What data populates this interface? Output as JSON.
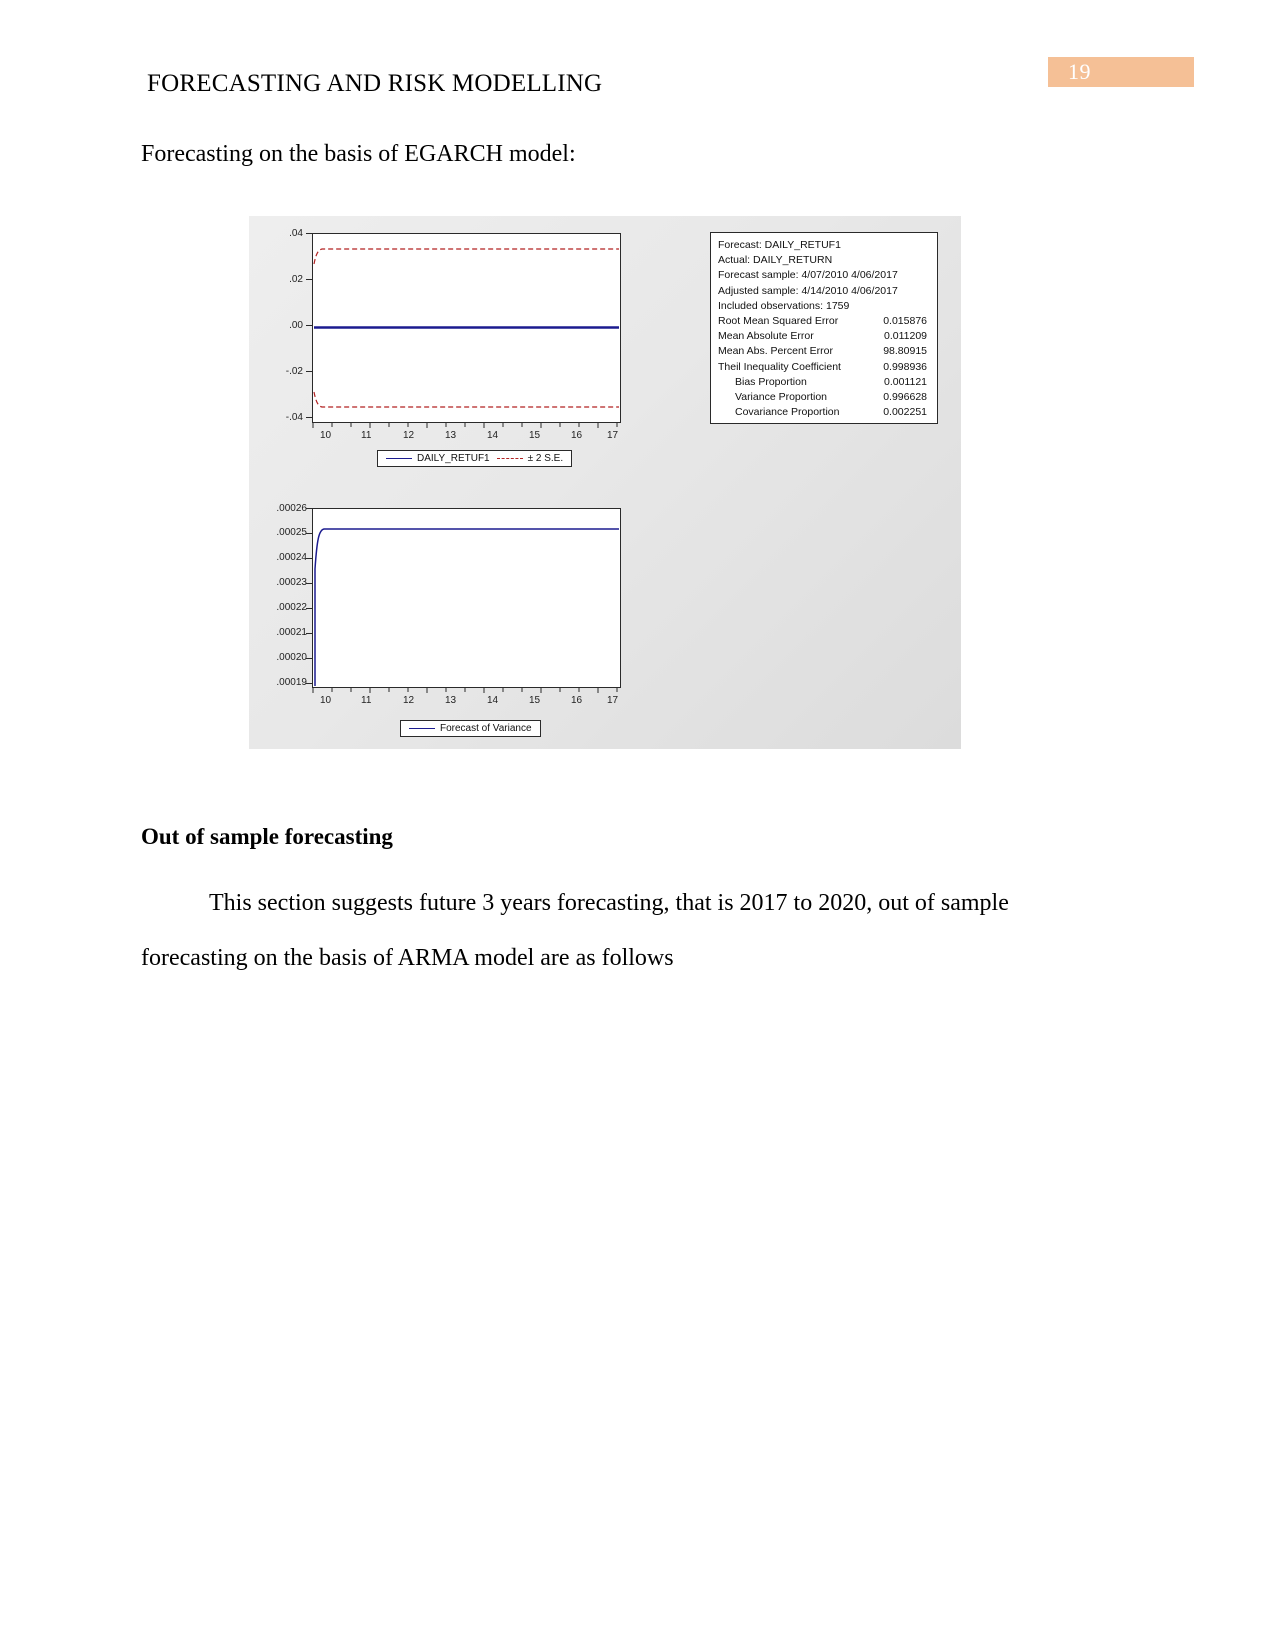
{
  "page": {
    "number": "19",
    "badge_color": "#f5c096",
    "header_title": "FORECASTING AND RISK MODELLING"
  },
  "body": {
    "intro_line": "Forecasting on the basis of EGARCH model:",
    "section_heading": "Out of sample forecasting",
    "paragraph_1": "This section suggests future 3 years forecasting, that is 2017 to 2020, out of sample",
    "paragraph_2": "forecasting on the basis of ARMA model are as follows"
  },
  "stats": {
    "forecast_label": "Forecast: DAILY_RETUF1",
    "actual_label": "Actual: DAILY_RETURN",
    "forecast_sample": "Forecast sample: 4/07/2010 4/06/2017",
    "adjusted_sample": "Adjusted sample: 4/14/2010 4/06/2017",
    "included_observations": "Included observations: 1759",
    "metrics": [
      {
        "label": "Root Mean Squared Error",
        "value": "0.015876",
        "indent": false
      },
      {
        "label": "Mean Absolute Error",
        "value": "0.011209",
        "indent": false
      },
      {
        "label": "Mean Abs. Percent Error",
        "value": "98.80915",
        "indent": false
      },
      {
        "label": "Theil Inequality Coefficient",
        "value": "0.998936",
        "indent": false
      },
      {
        "label": "Bias Proportion",
        "value": "0.001121",
        "indent": true
      },
      {
        "label": "Variance Proportion",
        "value": "0.996628",
        "indent": true
      },
      {
        "label": "Covariance Proportion",
        "value": "0.002251",
        "indent": true
      }
    ]
  },
  "chart_data": [
    {
      "type": "line",
      "title": "Forecast of DAILY_RETUF1 with +/- 2 S.E. bands",
      "xlabel": "",
      "ylabel": "",
      "x": [
        10,
        11,
        12,
        13,
        14,
        15,
        16,
        17
      ],
      "xtick_labels": [
        "10",
        "11",
        "12",
        "13",
        "14",
        "15",
        "16",
        "17"
      ],
      "ytick_labels": [
        ".04",
        ".02",
        ".00",
        "-.02",
        "-.04"
      ],
      "ylim": [
        -0.04,
        0.04
      ],
      "xlim": [
        10,
        17
      ],
      "grid": false,
      "legend_position": "bottom",
      "series": [
        {
          "name": "DAILY_RETUF1",
          "color": "#1b1b8f",
          "style": "solid",
          "values": [
            0.0002,
            0.0002,
            0.0002,
            0.0002,
            0.0002,
            0.0002,
            0.0002,
            0.0002
          ]
        },
        {
          "name": "+ 2 S.E.",
          "color": "#b22222",
          "style": "dashed",
          "values": [
            0.0275,
            0.0312,
            0.0315,
            0.0315,
            0.0315,
            0.0315,
            0.0315,
            0.0315
          ]
        },
        {
          "name": "- 2 S.E.",
          "color": "#b22222",
          "style": "dashed",
          "values": [
            -0.0272,
            -0.0308,
            -0.0312,
            -0.0312,
            -0.0312,
            -0.0312,
            -0.0312,
            -0.0312
          ]
        }
      ],
      "legend": [
        "DAILY_RETUF1",
        "± 2 S.E."
      ]
    },
    {
      "type": "line",
      "title": "Forecast of Variance",
      "xlabel": "",
      "ylabel": "",
      "x": [
        10,
        11,
        12,
        13,
        14,
        15,
        16,
        17
      ],
      "xtick_labels": [
        "10",
        "11",
        "12",
        "13",
        "14",
        "15",
        "16",
        "17"
      ],
      "ytick_labels": [
        ".00026",
        ".00025",
        ".00024",
        ".00023",
        ".00022",
        ".00021",
        ".00020",
        ".00019"
      ],
      "ylim": [
        0.00019,
        0.00026
      ],
      "xlim": [
        10,
        17
      ],
      "grid": false,
      "legend_position": "bottom",
      "series": [
        {
          "name": "Forecast of Variance",
          "color": "#1b1b8f",
          "style": "solid",
          "values": [
            0.00019,
            0.000251,
            0.000251,
            0.000251,
            0.000251,
            0.000251,
            0.000251,
            0.000251
          ]
        }
      ],
      "legend": [
        "Forecast of Variance"
      ]
    }
  ]
}
